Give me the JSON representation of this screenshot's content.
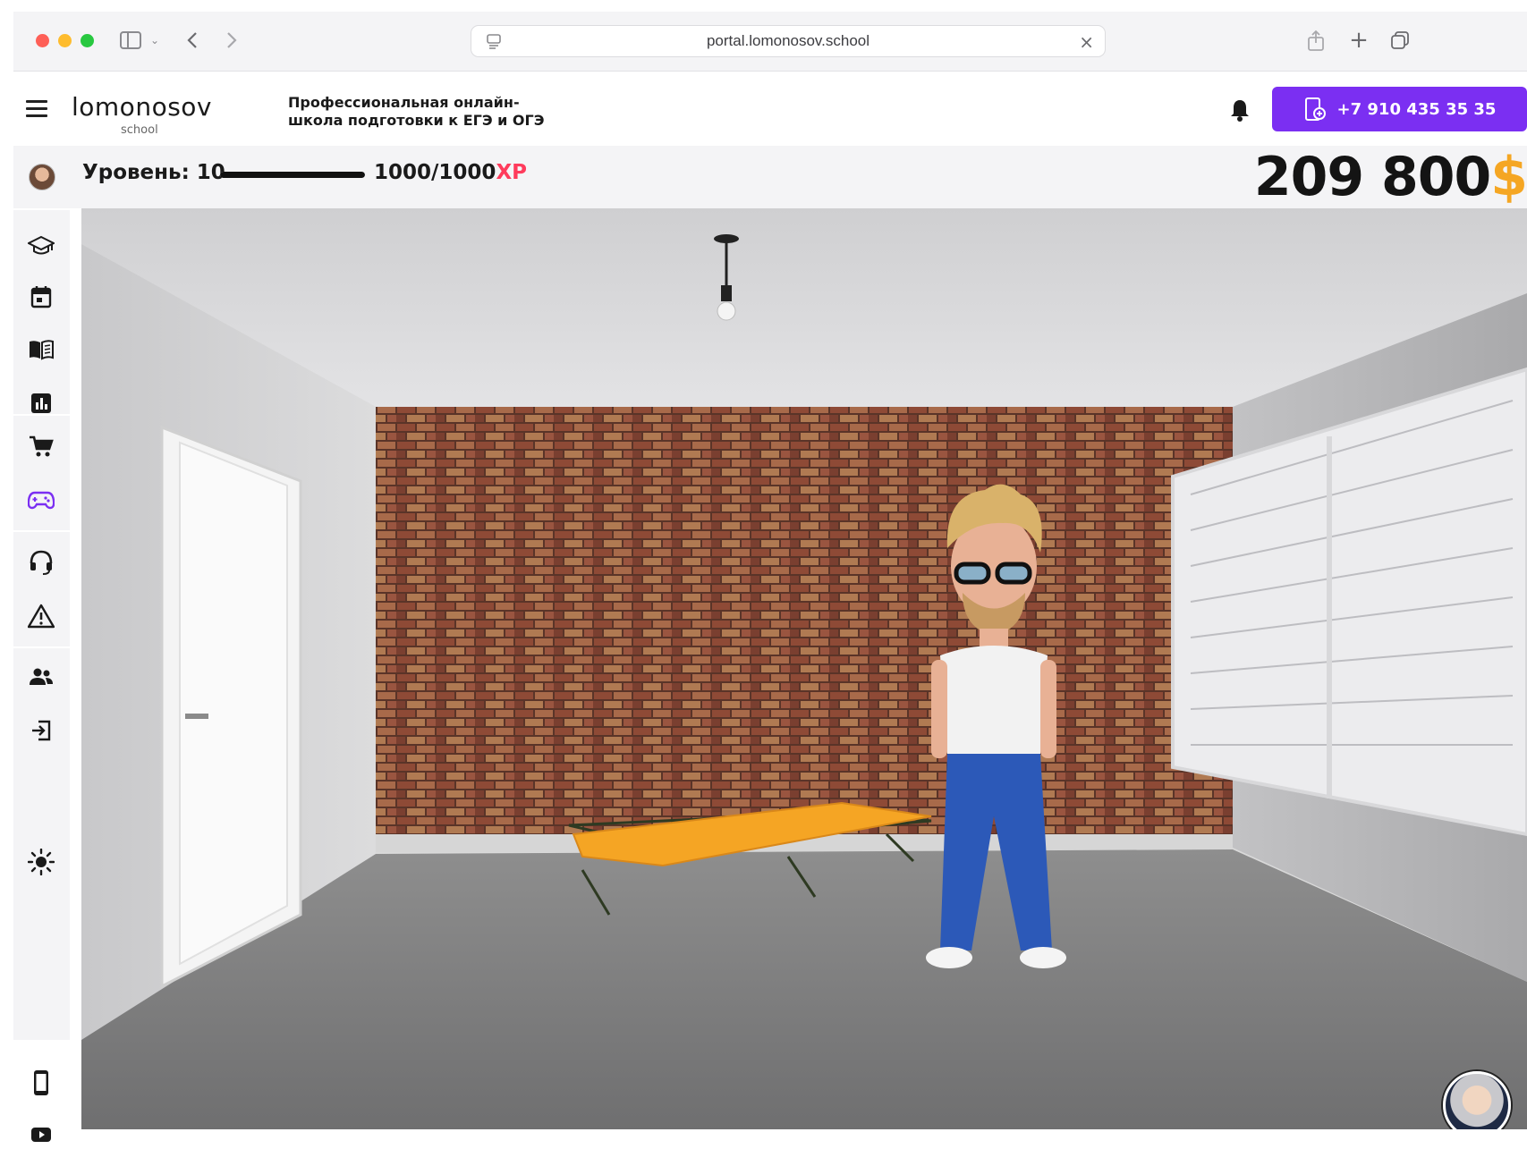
{
  "browser": {
    "url": "portal.lomonosov.school"
  },
  "header": {
    "logo_text": "lomonosov",
    "logo_sub": "school",
    "tagline_line1": "Профессиональная онлайн-",
    "tagline_line2": "школа подготовки к ЕГЭ и ОГЭ",
    "phone_label": "+7 910 435 35 35",
    "accent_color": "#7b2ff2"
  },
  "status": {
    "level_label": "Уровень: 10",
    "xp_value": "1000/1000",
    "xp_unit": "XP",
    "xp_progress": 1.0,
    "coins_value": "209 800",
    "coins_currency": "$"
  },
  "sidebar": {
    "items": [
      {
        "icon": "graduation-cap-icon"
      },
      {
        "icon": "calendar-icon"
      },
      {
        "icon": "book-icon"
      },
      {
        "icon": "stats-chart-icon"
      },
      {
        "icon": "cart-icon"
      },
      {
        "icon": "gamepad-icon",
        "active": true
      },
      {
        "icon": "headset-icon"
      },
      {
        "icon": "warning-icon"
      },
      {
        "icon": "users-icon"
      },
      {
        "icon": "logout-icon"
      },
      {
        "icon": "sun-icon"
      },
      {
        "icon": "mobile-icon"
      },
      {
        "icon": "youtube-icon"
      }
    ]
  }
}
